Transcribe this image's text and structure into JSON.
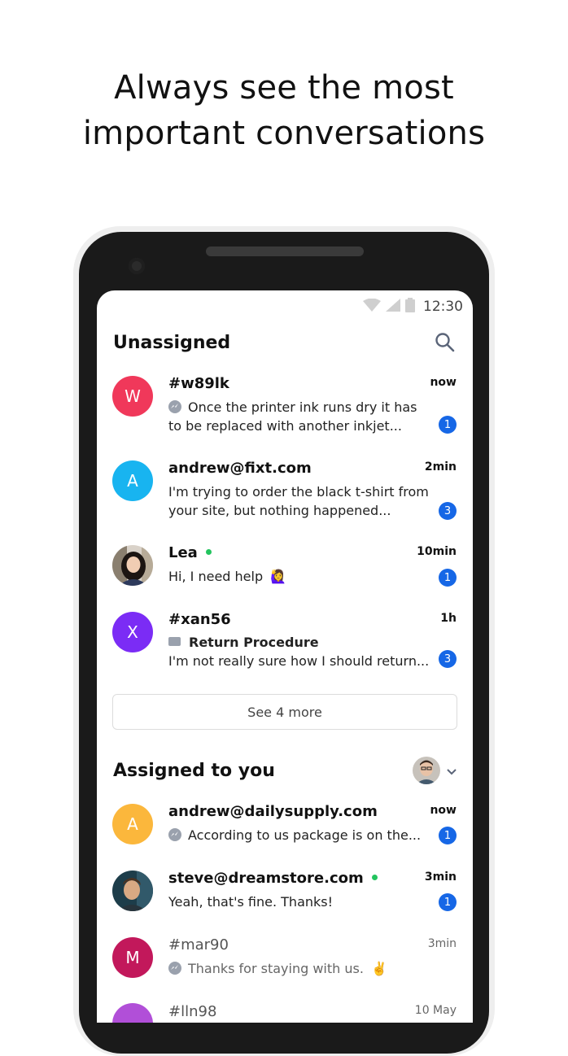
{
  "headline": {
    "line1": "Always see the most",
    "line2": "important conversations"
  },
  "status": {
    "time": "12:30"
  },
  "unassigned": {
    "title": "Unassigned",
    "search_icon": "search-icon",
    "items": [
      {
        "avatar_letter": "W",
        "avatar_color": "#f0385a",
        "name": "#w89lk",
        "time": "now",
        "line1": "Once the printer ink runs dry it has",
        "line2": "to be replaced with another inkjet...",
        "badge": "1",
        "channel": "messenger"
      },
      {
        "avatar_letter": "A",
        "avatar_color": "#18b4f0",
        "name": "andrew@fixt.com",
        "time": "2min",
        "line1": "I'm trying to order the black t-shirt from",
        "line2": "your site, but nothing happened...",
        "badge": "3"
      },
      {
        "name": "Lea",
        "time": "10min",
        "line1": "Hi, I need help",
        "emoji": "🙋‍♀️",
        "badge": "1",
        "online": true
      },
      {
        "avatar_letter": "X",
        "avatar_color": "#7b2cf5",
        "name": "#xan56",
        "time": "1h",
        "subject": "Return Procedure",
        "line2": "I'm not really sure how I should return...",
        "badge": "3",
        "channel": "email"
      }
    ],
    "see_more": "See 4 more"
  },
  "assigned": {
    "title": "Assigned to you",
    "items": [
      {
        "avatar_letter": "A",
        "avatar_color": "#fbb73c",
        "name": "andrew@dailysupply.com",
        "time": "now",
        "line1": "According to us package is on the...",
        "badge": "1",
        "channel": "messenger"
      },
      {
        "name": "steve@dreamstore.com",
        "time": "3min",
        "line1": "Yeah, that's fine. Thanks!",
        "badge": "1",
        "online": true
      },
      {
        "avatar_letter": "M",
        "avatar_color": "#c2185b",
        "name": "#mar90",
        "time": "3min",
        "line1": "Thanks for staying with us.",
        "emoji": "✌️",
        "channel": "messenger"
      },
      {
        "avatar_color": "#b14fd8",
        "name": "#lln98",
        "time": "10 May"
      }
    ]
  }
}
